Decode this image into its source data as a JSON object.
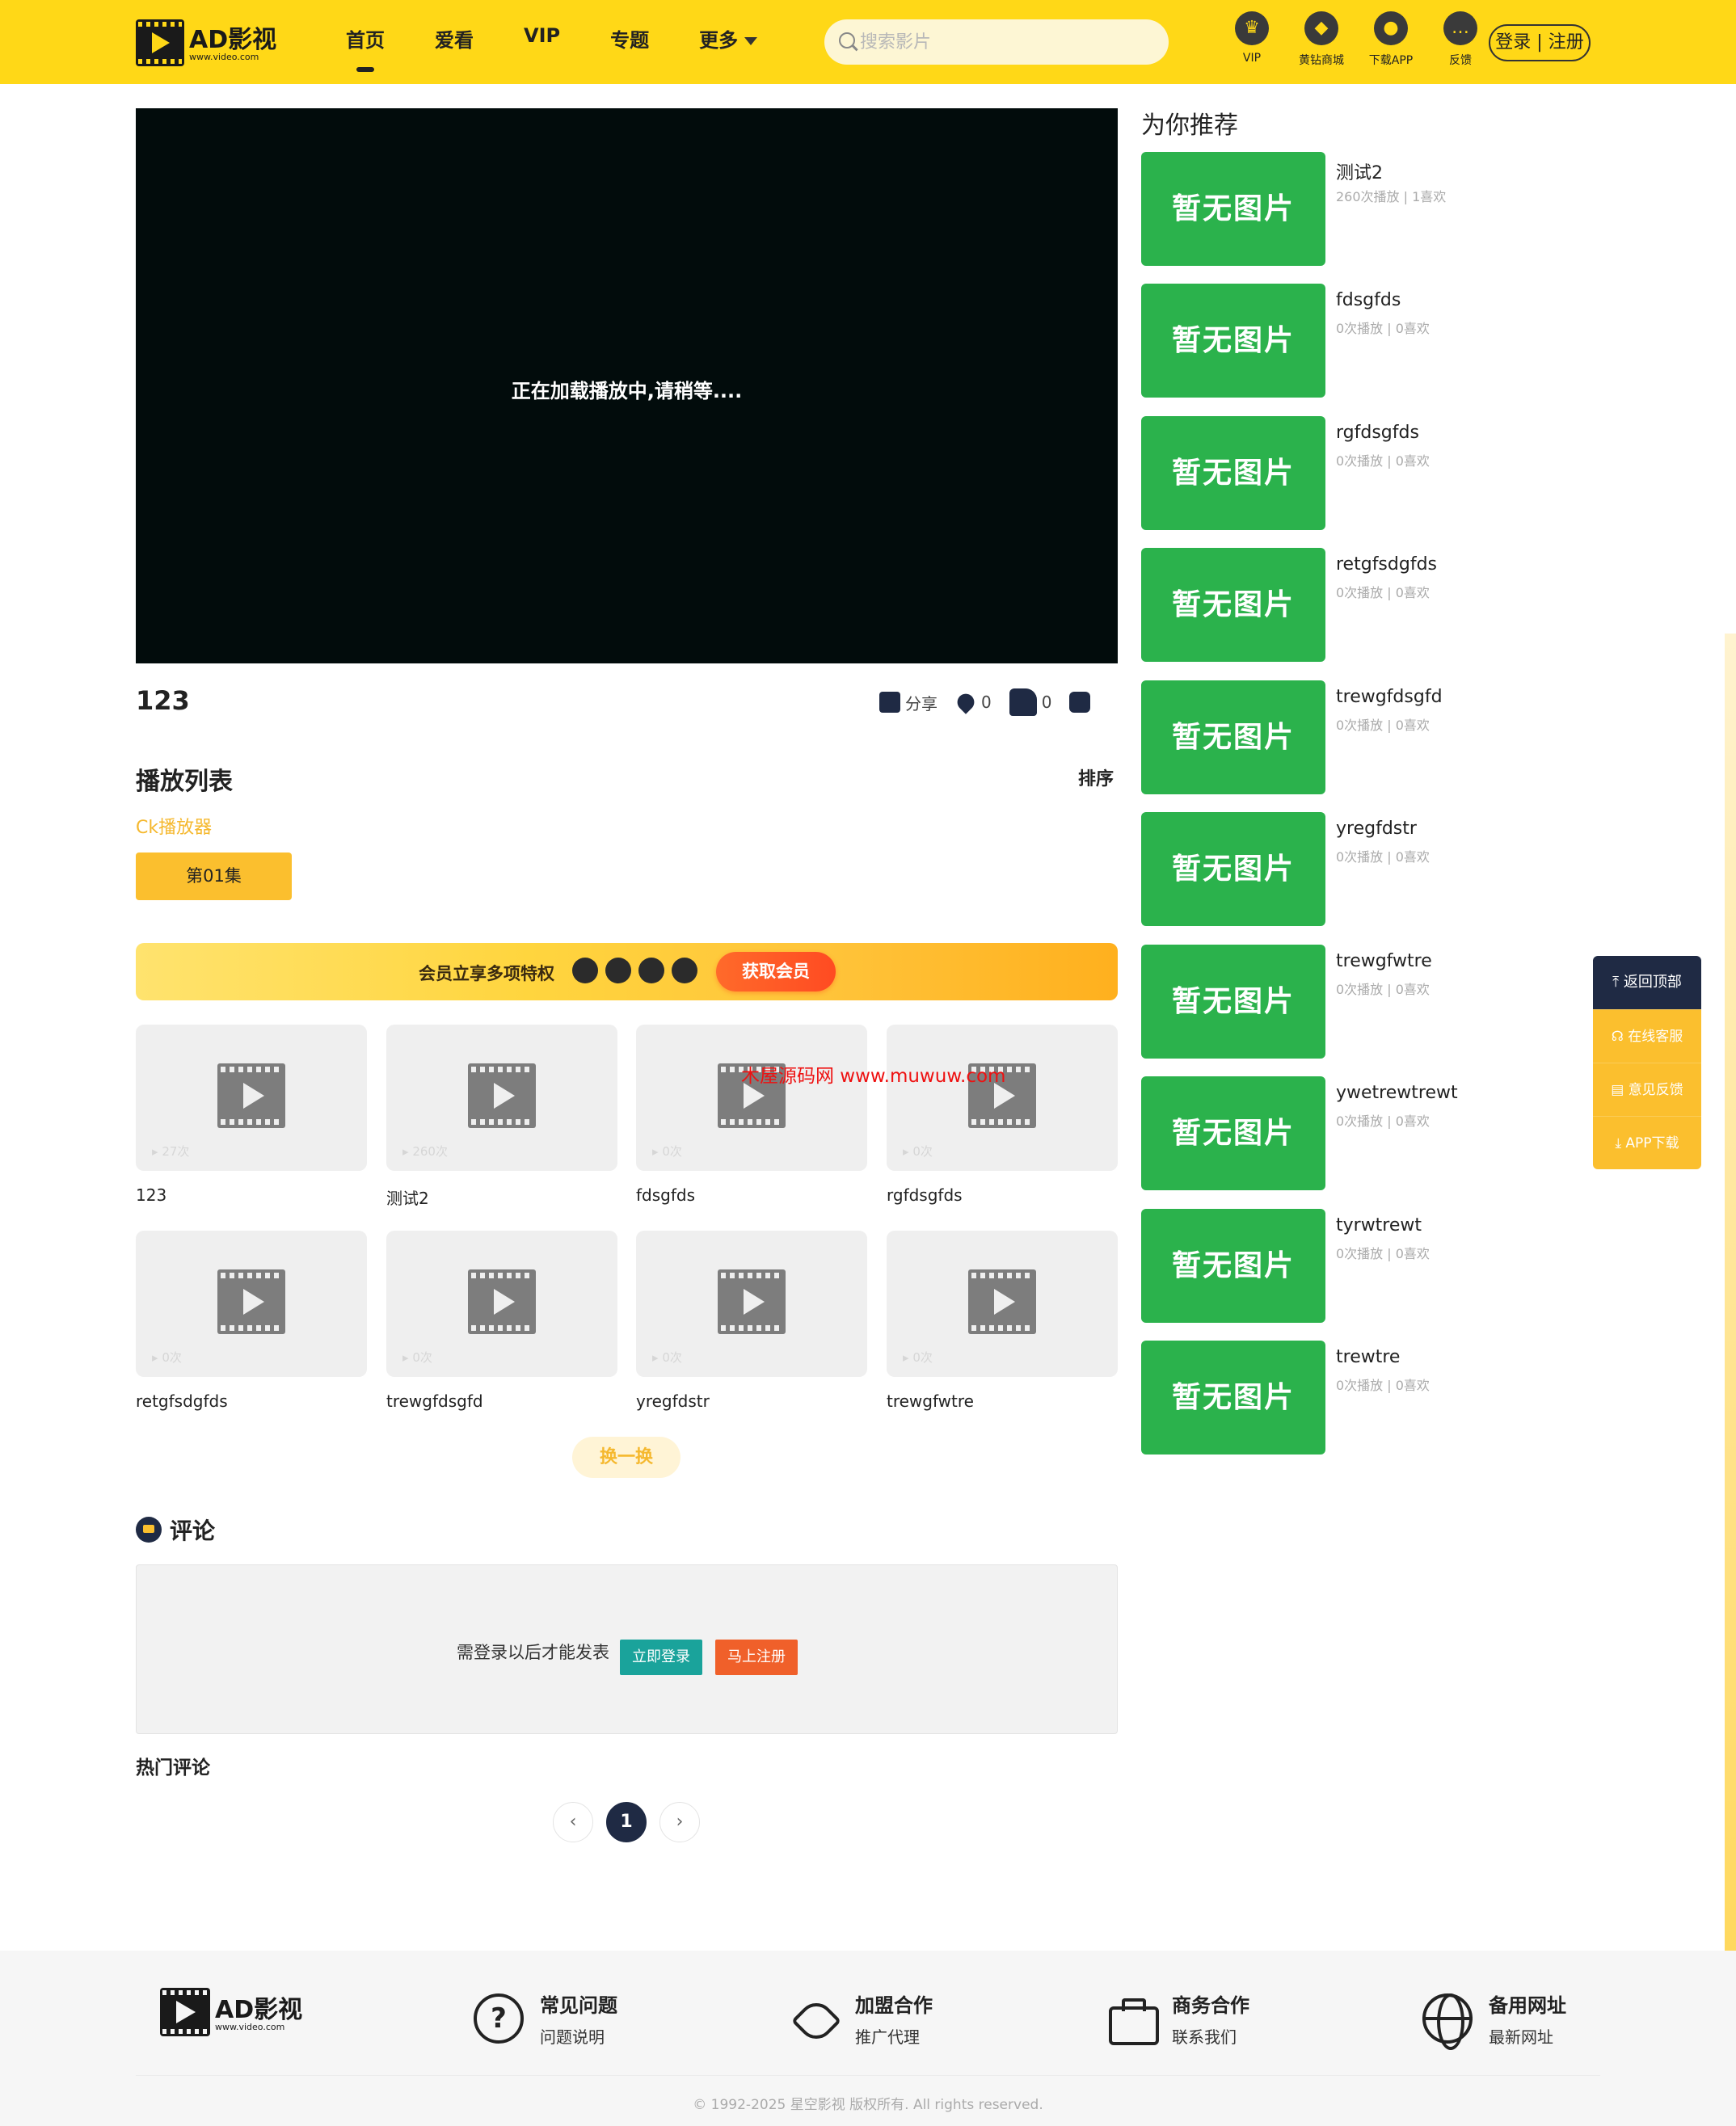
{
  "header": {
    "logo_name": "AD影视",
    "logo_url": "www.video.com",
    "nav": [
      "首页",
      "爱看",
      "VIP",
      "专题",
      "更多"
    ],
    "search_placeholder": "搜索影片",
    "icons": [
      {
        "label": "VIP",
        "icon": "crown-icon"
      },
      {
        "label": "黄钻商城",
        "icon": "diamond-icon"
      },
      {
        "label": "下载APP",
        "icon": "planet-icon"
      },
      {
        "label": "反馈",
        "icon": "chat-icon"
      }
    ],
    "login": "登录 | 注册"
  },
  "player": {
    "loading_text": "正在加载播放中,请稍等....",
    "title": "123",
    "share": "分享",
    "fav_count": "0",
    "like_count": "0"
  },
  "playlist": {
    "title": "播放列表",
    "sort": "排序",
    "source": "Ck播放器",
    "episodes": [
      "第01集"
    ]
  },
  "vip_banner": {
    "text": "会员立享多项特权",
    "button": "获取会员"
  },
  "videos": [
    {
      "title": "123",
      "plays": "27次"
    },
    {
      "title": "测试2",
      "plays": "260次"
    },
    {
      "title": "fdsgfds",
      "plays": "0次"
    },
    {
      "title": "rgfdsgfds",
      "plays": "0次"
    },
    {
      "title": "retgfsdgfds",
      "plays": "0次"
    },
    {
      "title": "trewgfdsgfd",
      "plays": "0次"
    },
    {
      "title": "yregfdstr",
      "plays": "0次"
    },
    {
      "title": "trewgfwtre",
      "plays": "0次"
    }
  ],
  "watermark": "木屋源码网 www.muwuw.com",
  "swap_button": "换一换",
  "comments": {
    "title": "评论",
    "need_login": "需登录以后才能发表",
    "login_btn": "立即登录",
    "register_btn": "马上注册",
    "hot": "热门评论",
    "pages": [
      "‹",
      "1",
      "›"
    ]
  },
  "recommend": {
    "title": "为你推荐",
    "no_image": "暂无图片",
    "items": [
      {
        "name": "测试2",
        "meta": "260次播放 | 1喜欢"
      },
      {
        "name": "fdsgfds",
        "meta": "0次播放 | 0喜欢"
      },
      {
        "name": "rgfdsgfds",
        "meta": "0次播放 | 0喜欢"
      },
      {
        "name": "retgfsdgfds",
        "meta": "0次播放 | 0喜欢"
      },
      {
        "name": "trewgfdsgfd",
        "meta": "0次播放 | 0喜欢"
      },
      {
        "name": "yregfdstr",
        "meta": "0次播放 | 0喜欢"
      },
      {
        "name": "trewgfwtre",
        "meta": "0次播放 | 0喜欢"
      },
      {
        "name": "ywetrewtrewt",
        "meta": "0次播放 | 0喜欢"
      },
      {
        "name": "tyrwtrewt",
        "meta": "0次播放 | 0喜欢"
      },
      {
        "name": "trewtre",
        "meta": "0次播放 | 0喜欢"
      }
    ]
  },
  "floatbar": {
    "top": "返回顶部",
    "service": "在线客服",
    "feedback": "意见反馈",
    "app": "APP下载"
  },
  "footer": {
    "logo_name": "AD影视",
    "logo_url": "www.video.com",
    "items": [
      {
        "title": "常见问题",
        "sub": "问题说明",
        "icon": "question-icon"
      },
      {
        "title": "加盟合作",
        "sub": "推广代理",
        "icon": "handshake-heart-icon"
      },
      {
        "title": "商务合作",
        "sub": "联系我们",
        "icon": "briefcase-icon"
      },
      {
        "title": "备用网址",
        "sub": "最新网址",
        "icon": "globe-icon"
      }
    ],
    "copyright": "© 1992-2025 星空影视 版权所有. All rights reserved."
  },
  "colors": {
    "brand_yellow": "#FFD817",
    "accent_orange": "#FBBF2E",
    "no_image_green": "#2BB24C",
    "dark_navy": "#1f2a44"
  }
}
